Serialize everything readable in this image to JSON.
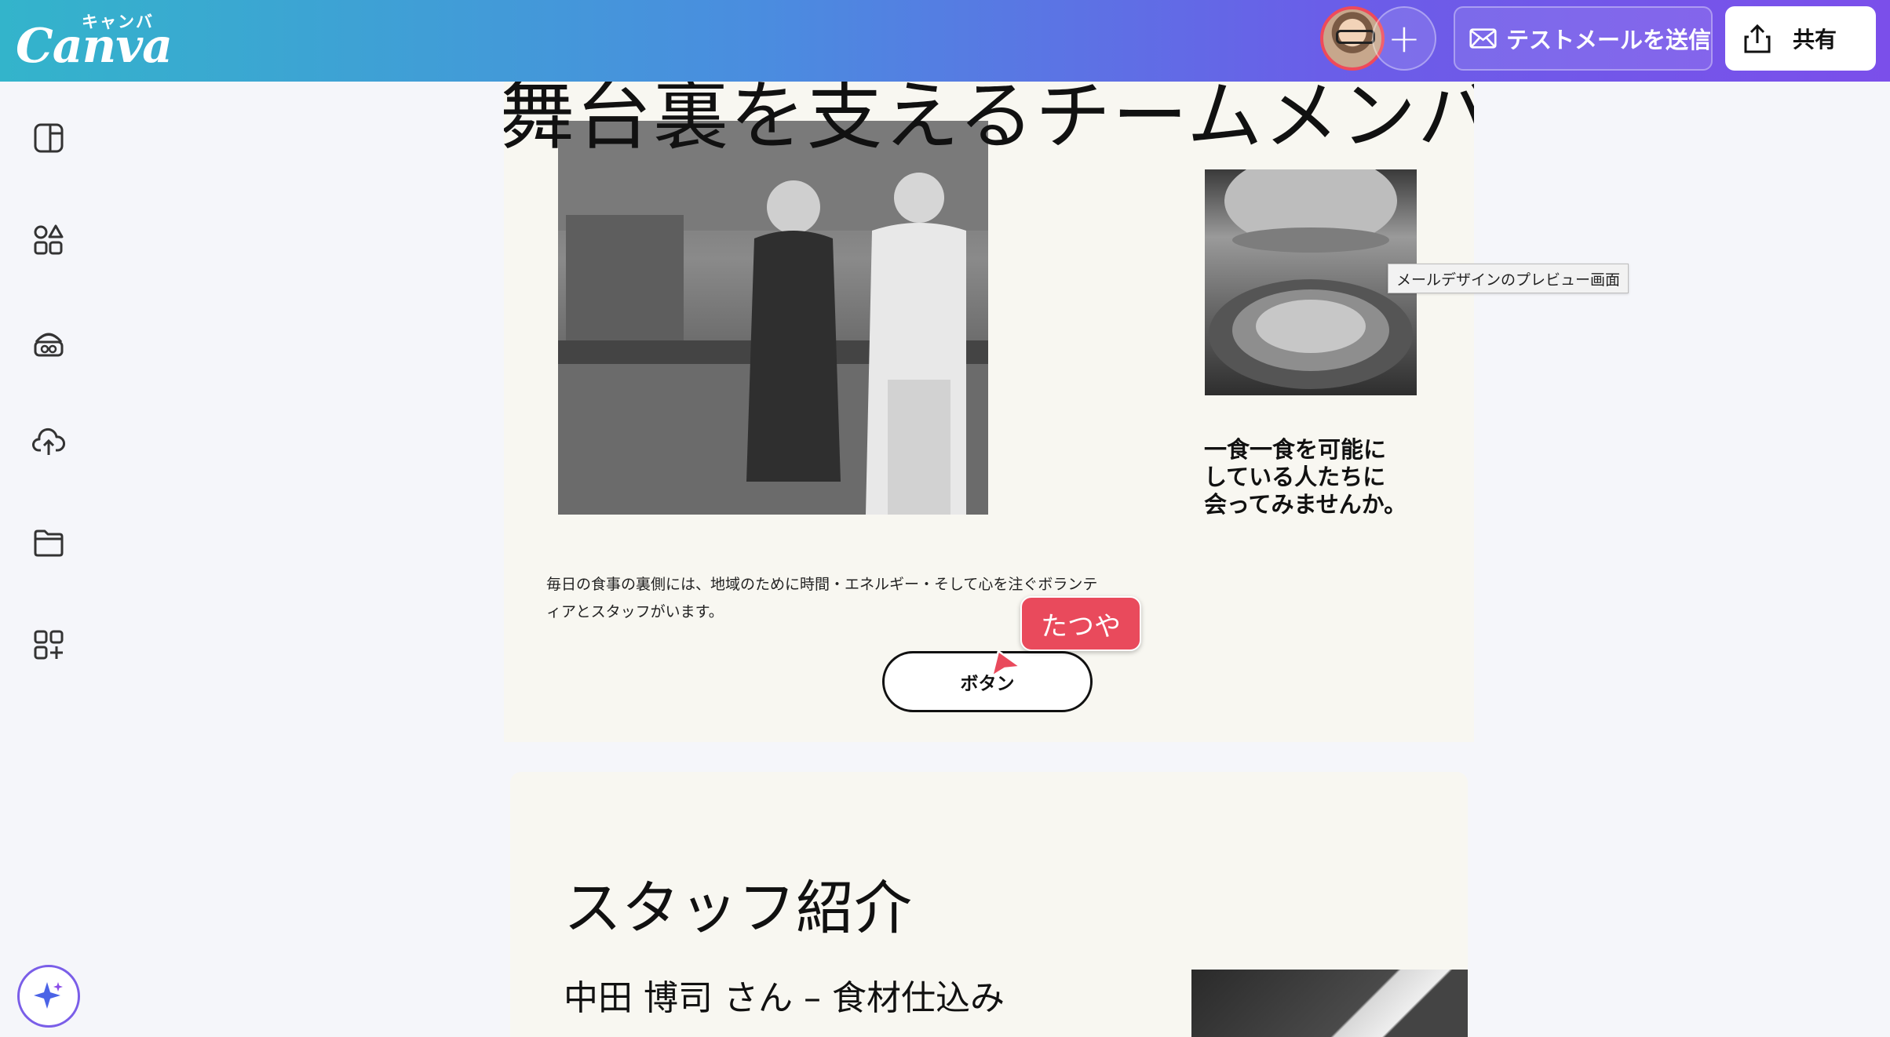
{
  "header": {
    "logo": "Canva",
    "logo_kana": "キャンバ",
    "test_email_label": "テストメールを送信",
    "share_label": "共有"
  },
  "sidebar": {
    "items": [
      {
        "icon": "panel-layout-icon"
      },
      {
        "icon": "elements-icon"
      },
      {
        "icon": "brand-icon"
      },
      {
        "icon": "upload-icon"
      },
      {
        "icon": "projects-folder-icon"
      },
      {
        "icon": "apps-icon"
      }
    ],
    "magic_icon": "sparkle-icon"
  },
  "canvas": {
    "headline": "舞台裏を支えるチームメンバー",
    "side_text": [
      "一食一食を可能に",
      "している人たちに",
      "会ってみませんか。"
    ],
    "body_text": "毎日の食事の裏側には、地域のために時間・エネルギー・そして心を注ぐボランティアとスタッフがいます。",
    "button_label": "ボタン",
    "staff_title": "スタッフ紹介",
    "staff_name": "中田 博司 さん – 食材仕込み"
  },
  "tooltip": "メールデザインのプレビュー画面",
  "collaborator": {
    "name": "たつや",
    "color": "#e94a5c"
  },
  "colors": {
    "header_start": "#33b4cb",
    "header_end": "#7b4fea",
    "canvas_bg": "#f8f7f1"
  }
}
